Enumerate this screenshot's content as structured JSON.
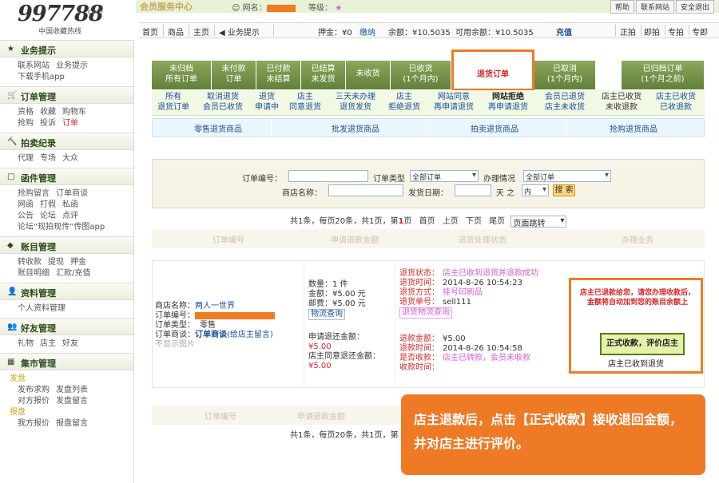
{
  "logo": {
    "number": "997788",
    "dotcom": ".com",
    "subtitle": "中国收藏热线"
  },
  "header": {
    "member_title": "会员服务中心",
    "netname_label": "网名：",
    "level_label": "等级：",
    "level_star": "★"
  },
  "top_links": [
    "帮助",
    "联系网站",
    "安全退出"
  ],
  "nav": {
    "left": [
      "首页",
      "商品",
      "主页"
    ],
    "notice": "业务提示",
    "deposit": "押金：¥0",
    "pay": "缴纳",
    "balance": "余额：¥10.5035",
    "available": "可用余额：¥10.5035",
    "charge": "充值",
    "right": [
      "正拍",
      "即拍",
      "专拍",
      "专即"
    ]
  },
  "sidebar": [
    {
      "title": "业务提示",
      "icon": "★",
      "links": [
        [
          "联系网站",
          "业务提示"
        ],
        [
          "下载手机app"
        ]
      ]
    },
    {
      "title": "订单管理",
      "icon": "🛒",
      "links": [
        [
          "资格",
          "收藏",
          "购物车"
        ],
        [
          "抢购",
          "投诉",
          "订单"
        ]
      ]
    },
    {
      "title": "拍卖纪录",
      "icon": "🔨",
      "links": [
        [
          "代理",
          "专场",
          "大众"
        ]
      ]
    },
    {
      "title": "函件管理",
      "icon": "□",
      "links": [
        [
          "抢购留言",
          "订单商谈"
        ],
        [
          "网函",
          "打假",
          "私函"
        ],
        [
          "公告",
          "论坛",
          "点评"
        ],
        [
          "论坛“现拍现传”传图app"
        ]
      ]
    },
    {
      "title": "账目管理",
      "icon": "◆",
      "links": [
        [
          "转收款",
          "提现",
          "押金"
        ],
        [
          "账目明细",
          "汇款/充值"
        ]
      ]
    },
    {
      "title": "资料管理",
      "icon": "👤",
      "links": [
        [
          "个人资料管理"
        ]
      ]
    },
    {
      "title": "好友管理",
      "icon": "👥",
      "links": [
        [
          "礼物",
          "店主",
          "好友"
        ]
      ]
    },
    {
      "title": "集市管理",
      "icon": "▦",
      "links": [
        [
          "发盘"
        ],
        [
          "发布求购",
          "发盘列表"
        ],
        [
          "对方报价",
          "发盘留言"
        ],
        [
          "报盘"
        ],
        [
          "我方报价",
          "报盘留言"
        ]
      ]
    }
  ],
  "tabs": [
    {
      "l1": "未归档",
      "l2": "所有订单"
    },
    {
      "l1": "未付款",
      "l2": "订单"
    },
    {
      "l1": "已付款",
      "l2": "未结算"
    },
    {
      "l1": "已结算",
      "l2": "未发货"
    },
    {
      "l1": "未收货",
      "l2": ""
    },
    {
      "l1": "已收货",
      "l2": "(1个月内)"
    },
    {
      "l1": "退货订单",
      "l2": ""
    },
    {
      "l1": "已取消",
      "l2": "(1个月内)"
    },
    {
      "l1": "已归档订单",
      "l2": "(1个月之前)"
    }
  ],
  "subtabs": [
    {
      "l1": "所有",
      "l2": "退货订单"
    },
    {
      "l1": "取消退货",
      "l2": "会员已收货"
    },
    {
      "l1": "退货",
      "l2": "申请中"
    },
    {
      "l1": "店主",
      "l2": "同意退货"
    },
    {
      "l1": "三天未办理",
      "l2": "退货发货"
    },
    {
      "l1": "店主",
      "l2": "拒绝退货"
    },
    {
      "l1": "网站同意",
      "l2": "再申请退货"
    },
    {
      "l1": "网站拒绝",
      "l2": "再申请退货"
    },
    {
      "l1": "会员已退货",
      "l2": "店主未收货"
    },
    {
      "l1": "店主已收货",
      "l2": "未收退款"
    },
    {
      "l1": "店主已收货",
      "l2": "已收退款"
    }
  ],
  "categories": [
    "零售退货商品",
    "批发退货商品",
    "拍卖退货商品",
    "抢购退货商品"
  ],
  "search": {
    "order_no_label": "订单编号：",
    "order_type_label": "订单类型",
    "order_type_value": "全部订单",
    "status_label": "办理情况",
    "status_value": "全部订单",
    "shop_label": "商店名称：",
    "ship_date_label": "发货日期：",
    "days_label": "天 之",
    "days_value": "内",
    "search_button": "搜 索"
  },
  "pager": {
    "prefix": "共1条，每页20条，共1页，第",
    "current": "1",
    "suffix": "页",
    "links": [
      "首页",
      "上页",
      "下页",
      "尾页"
    ],
    "jump": "页面跳转"
  },
  "columns_top": [
    "订单编号",
    "申请退款金额",
    "退货处理状态",
    "办理业务"
  ],
  "columns_bottom": [
    "订单编号",
    "申请退款金额"
  ],
  "pager_bottom": "共1条，每页20条，共1页，第",
  "order": {
    "shop_label": "商店名称：",
    "shop": "两人一世界",
    "order_no_label": "订单编号：",
    "type_label": "订单类型：",
    "type": "零售",
    "talk_label": "订单商谈：",
    "talk": "订单商谈",
    "talk_note": "(给店主留言)",
    "no_image": "不显示图片",
    "qty": "数量：1 件",
    "amount": "金额：¥5.00 元",
    "postage": "邮费：¥5.00 元",
    "logistics": "物流查询",
    "refund_apply_label": "申请退还金额：",
    "refund_apply": "¥5.00",
    "refund_agree_label": "店主同意退还金额：",
    "refund_agree": "¥5.00",
    "status_label": "退货状态：",
    "status": "店主已收到退货并退款成功",
    "ret_time_label": "退货时间：",
    "ret_time": "2014-8-26 10:54:23",
    "ret_method_label": "退货方式：",
    "ret_method": "挂号印刷品",
    "ret_no_label": "退货单号：",
    "ret_no": "sell111",
    "ret_logistics": "退货物流查询",
    "refund_amount_label": "退款金额：",
    "refund_amount": "¥5.00",
    "refund_time_label": "退款时间：",
    "refund_time": "2014-8-26 10:54:58",
    "received_label": "是否收款：",
    "received": "店主已转款，会员未收款",
    "receipt_time_label": "收款时间："
  },
  "notice": {
    "text": "店主已退款给您，请您办理收款后，金额将自动加到您的账目余额上",
    "button": "正式收款，评价店主",
    "waiting": "店主已收到退货"
  },
  "callout": "店主退款后，点击【正式收款】接收退回金额，并对店主进行评价。",
  "colors": {
    "accent": "#ef7b22",
    "tab_green": "#61803a",
    "link": "#1a4f9c",
    "red": "#d62828"
  }
}
